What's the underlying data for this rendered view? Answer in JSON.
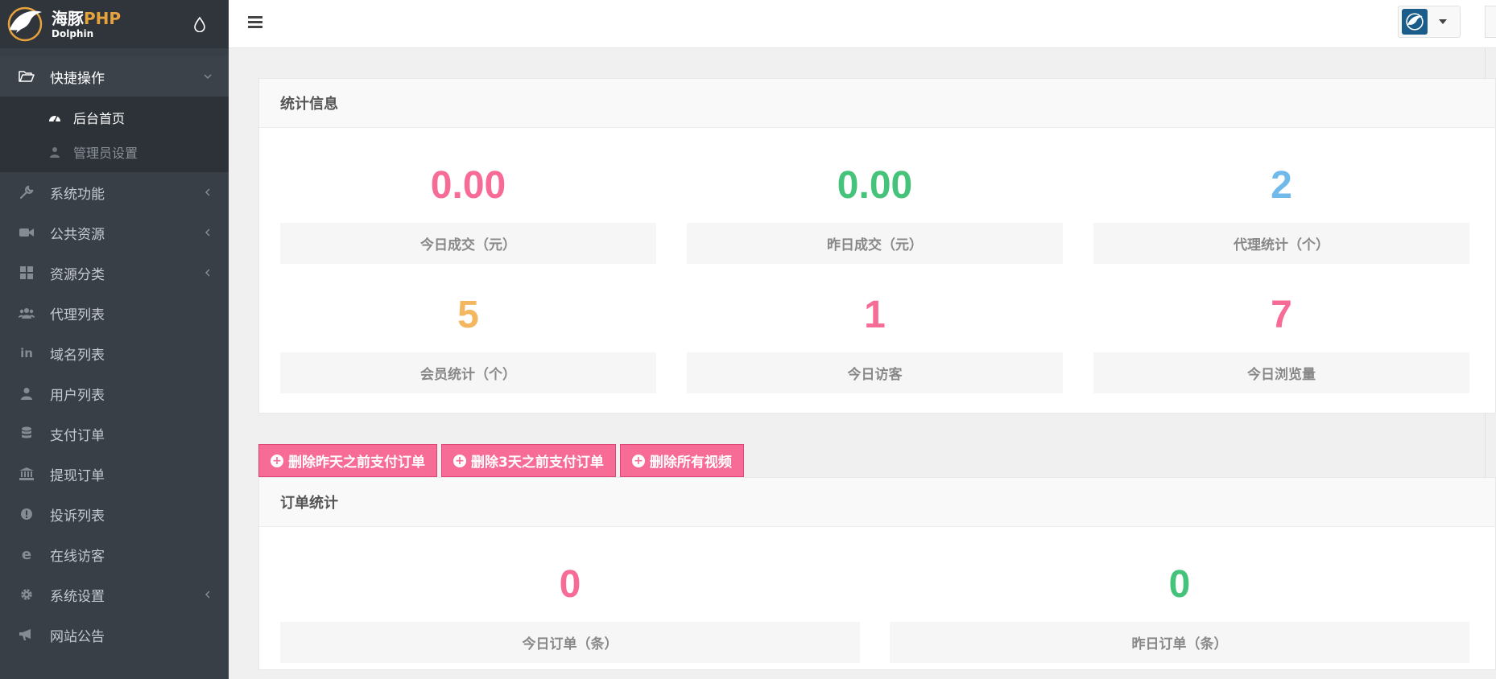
{
  "brand": {
    "name_cn": "海豚",
    "name_php": "PHP",
    "subtitle": "Dolphin"
  },
  "colors": {
    "pink": "#f66c97",
    "green": "#46c37b",
    "blue": "#70b9eb",
    "orange": "#f3b760",
    "sidebar": "#393f46"
  },
  "sidebar": {
    "items": [
      {
        "label": "快捷操作",
        "icon": "folder-open-icon",
        "expanded": true,
        "children": [
          {
            "label": "后台首页",
            "icon": "dashboard-icon",
            "active": true
          },
          {
            "label": "管理员设置",
            "icon": "user-icon",
            "active": false
          }
        ]
      },
      {
        "label": "系统功能",
        "icon": "wrench-icon",
        "has_children": true
      },
      {
        "label": "公共资源",
        "icon": "video-camera-icon",
        "has_children": true
      },
      {
        "label": "资源分类",
        "icon": "grid-icon",
        "has_children": true
      },
      {
        "label": "代理列表",
        "icon": "users-icon"
      },
      {
        "label": "域名列表",
        "icon": "linkedin-icon"
      },
      {
        "label": "用户列表",
        "icon": "user-icon"
      },
      {
        "label": "支付订单",
        "icon": "database-icon"
      },
      {
        "label": "提现订单",
        "icon": "bank-icon"
      },
      {
        "label": "投诉列表",
        "icon": "exclamation-circle-icon"
      },
      {
        "label": "在线访客",
        "icon": "internet-explorer-icon"
      },
      {
        "label": "系统设置",
        "icon": "gear-icon",
        "has_children": true
      },
      {
        "label": "网站公告",
        "icon": "bullhorn-icon"
      }
    ]
  },
  "stats_panel": {
    "title": "统计信息",
    "stats": [
      {
        "value": "0.00",
        "label": "今日成交（元）",
        "color": "#f66c97"
      },
      {
        "value": "0.00",
        "label": "昨日成交（元）",
        "color": "#46c37b"
      },
      {
        "value": "2",
        "label": "代理统计（个）",
        "color": "#70b9eb"
      },
      {
        "value": "5",
        "label": "会员统计（个）",
        "color": "#f3b760"
      },
      {
        "value": "1",
        "label": "今日访客",
        "color": "#f66c97"
      },
      {
        "value": "7",
        "label": "今日浏览量",
        "color": "#f66c97"
      }
    ]
  },
  "actions": [
    {
      "label": "删除昨天之前支付订单"
    },
    {
      "label": "删除3天之前支付订单"
    },
    {
      "label": "删除所有视频"
    }
  ],
  "orders_panel": {
    "title": "订单统计",
    "stats": [
      {
        "value": "0",
        "label": "今日订单（条）",
        "color": "#f66c97"
      },
      {
        "value": "0",
        "label": "昨日订单（条）",
        "color": "#46c37b"
      }
    ]
  }
}
